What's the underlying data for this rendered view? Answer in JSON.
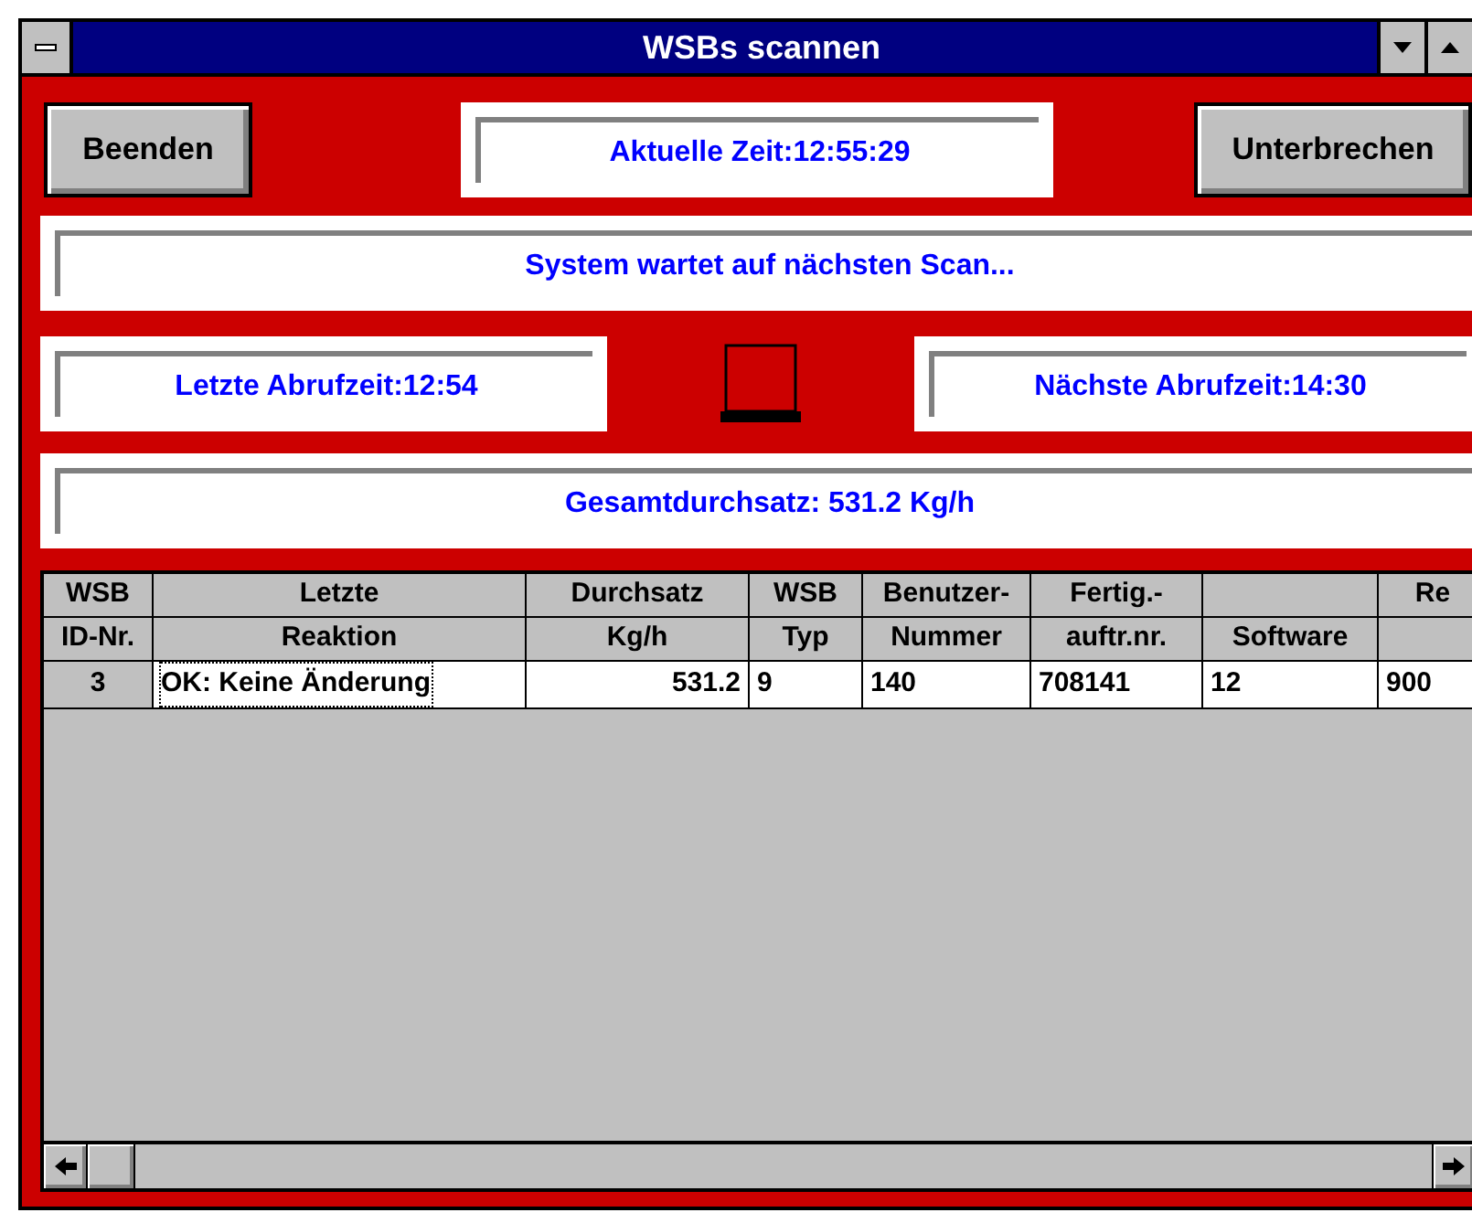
{
  "window": {
    "title": "WSBs scannen"
  },
  "buttons": {
    "quit": "Beenden",
    "pause": "Unterbrechen"
  },
  "current_time": "Aktuelle Zeit:12:55:29",
  "status": "System wartet auf nächsten Scan...",
  "last_poll": "Letzte Abrufzeit:12:54",
  "next_poll": "Nächste Abrufzeit:14:30",
  "total_throughput": "Gesamtdurchsatz: 531.2 Kg/h",
  "table": {
    "columns": [
      {
        "line1": "WSB",
        "line2": "ID-Nr."
      },
      {
        "line1": "Letzte",
        "line2": "Reaktion"
      },
      {
        "line1": "Durchsatz",
        "line2": "Kg/h"
      },
      {
        "line1": "WSB",
        "line2": "Typ"
      },
      {
        "line1": "Benutzer-",
        "line2": "Nummer"
      },
      {
        "line1": "Fertig.-",
        "line2": "auftr.nr."
      },
      {
        "line2": "Software"
      },
      {
        "line1": "Re"
      }
    ],
    "rows": [
      {
        "cells": [
          {
            "text": "3",
            "focused": false
          },
          {
            "text": "OK: Keine Änderung",
            "focused": true
          },
          {
            "text": "531.2",
            "focused": false
          },
          {
            "text": "9",
            "focused": false
          },
          {
            "text": "140",
            "focused": false
          },
          {
            "text": "708141",
            "focused": false
          },
          {
            "text": "12",
            "focused": false
          },
          {
            "text": "900",
            "focused": false
          }
        ]
      }
    ]
  }
}
